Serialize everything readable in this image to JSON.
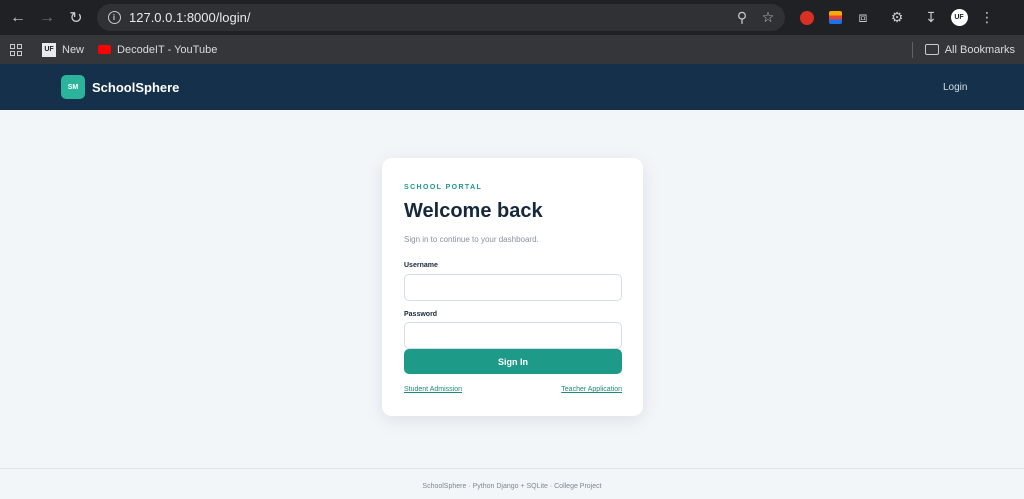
{
  "browser": {
    "url": "127.0.0.1:8000/login/",
    "bookmarks": [
      {
        "label": "New"
      },
      {
        "label": "DecodeIT - YouTube"
      }
    ],
    "all_bookmarks_label": "All Bookmarks",
    "profile_initials": "UF",
    "bookmark_uf_icon_text": "UF"
  },
  "header": {
    "logo_badge": "SM",
    "site_name": "SchoolSphere",
    "nav_login": "Login"
  },
  "login_card": {
    "eyebrow": "SCHOOL PORTAL",
    "title": "Welcome back",
    "subtitle": "Sign in to continue to your dashboard.",
    "username_label": "Username",
    "username_value": "",
    "password_label": "Password",
    "password_value": "",
    "submit_label": "Sign In",
    "student_link": "Student Admission",
    "teacher_link": "Teacher Application"
  },
  "footer": {
    "text": "SchoolSphere · Python Django + SQLite · College Project"
  },
  "colors": {
    "header_bg": "#14304a",
    "accent": "#1e9a88",
    "logo_badge": "#2bb39b",
    "page_bg": "#f3f6f9"
  }
}
